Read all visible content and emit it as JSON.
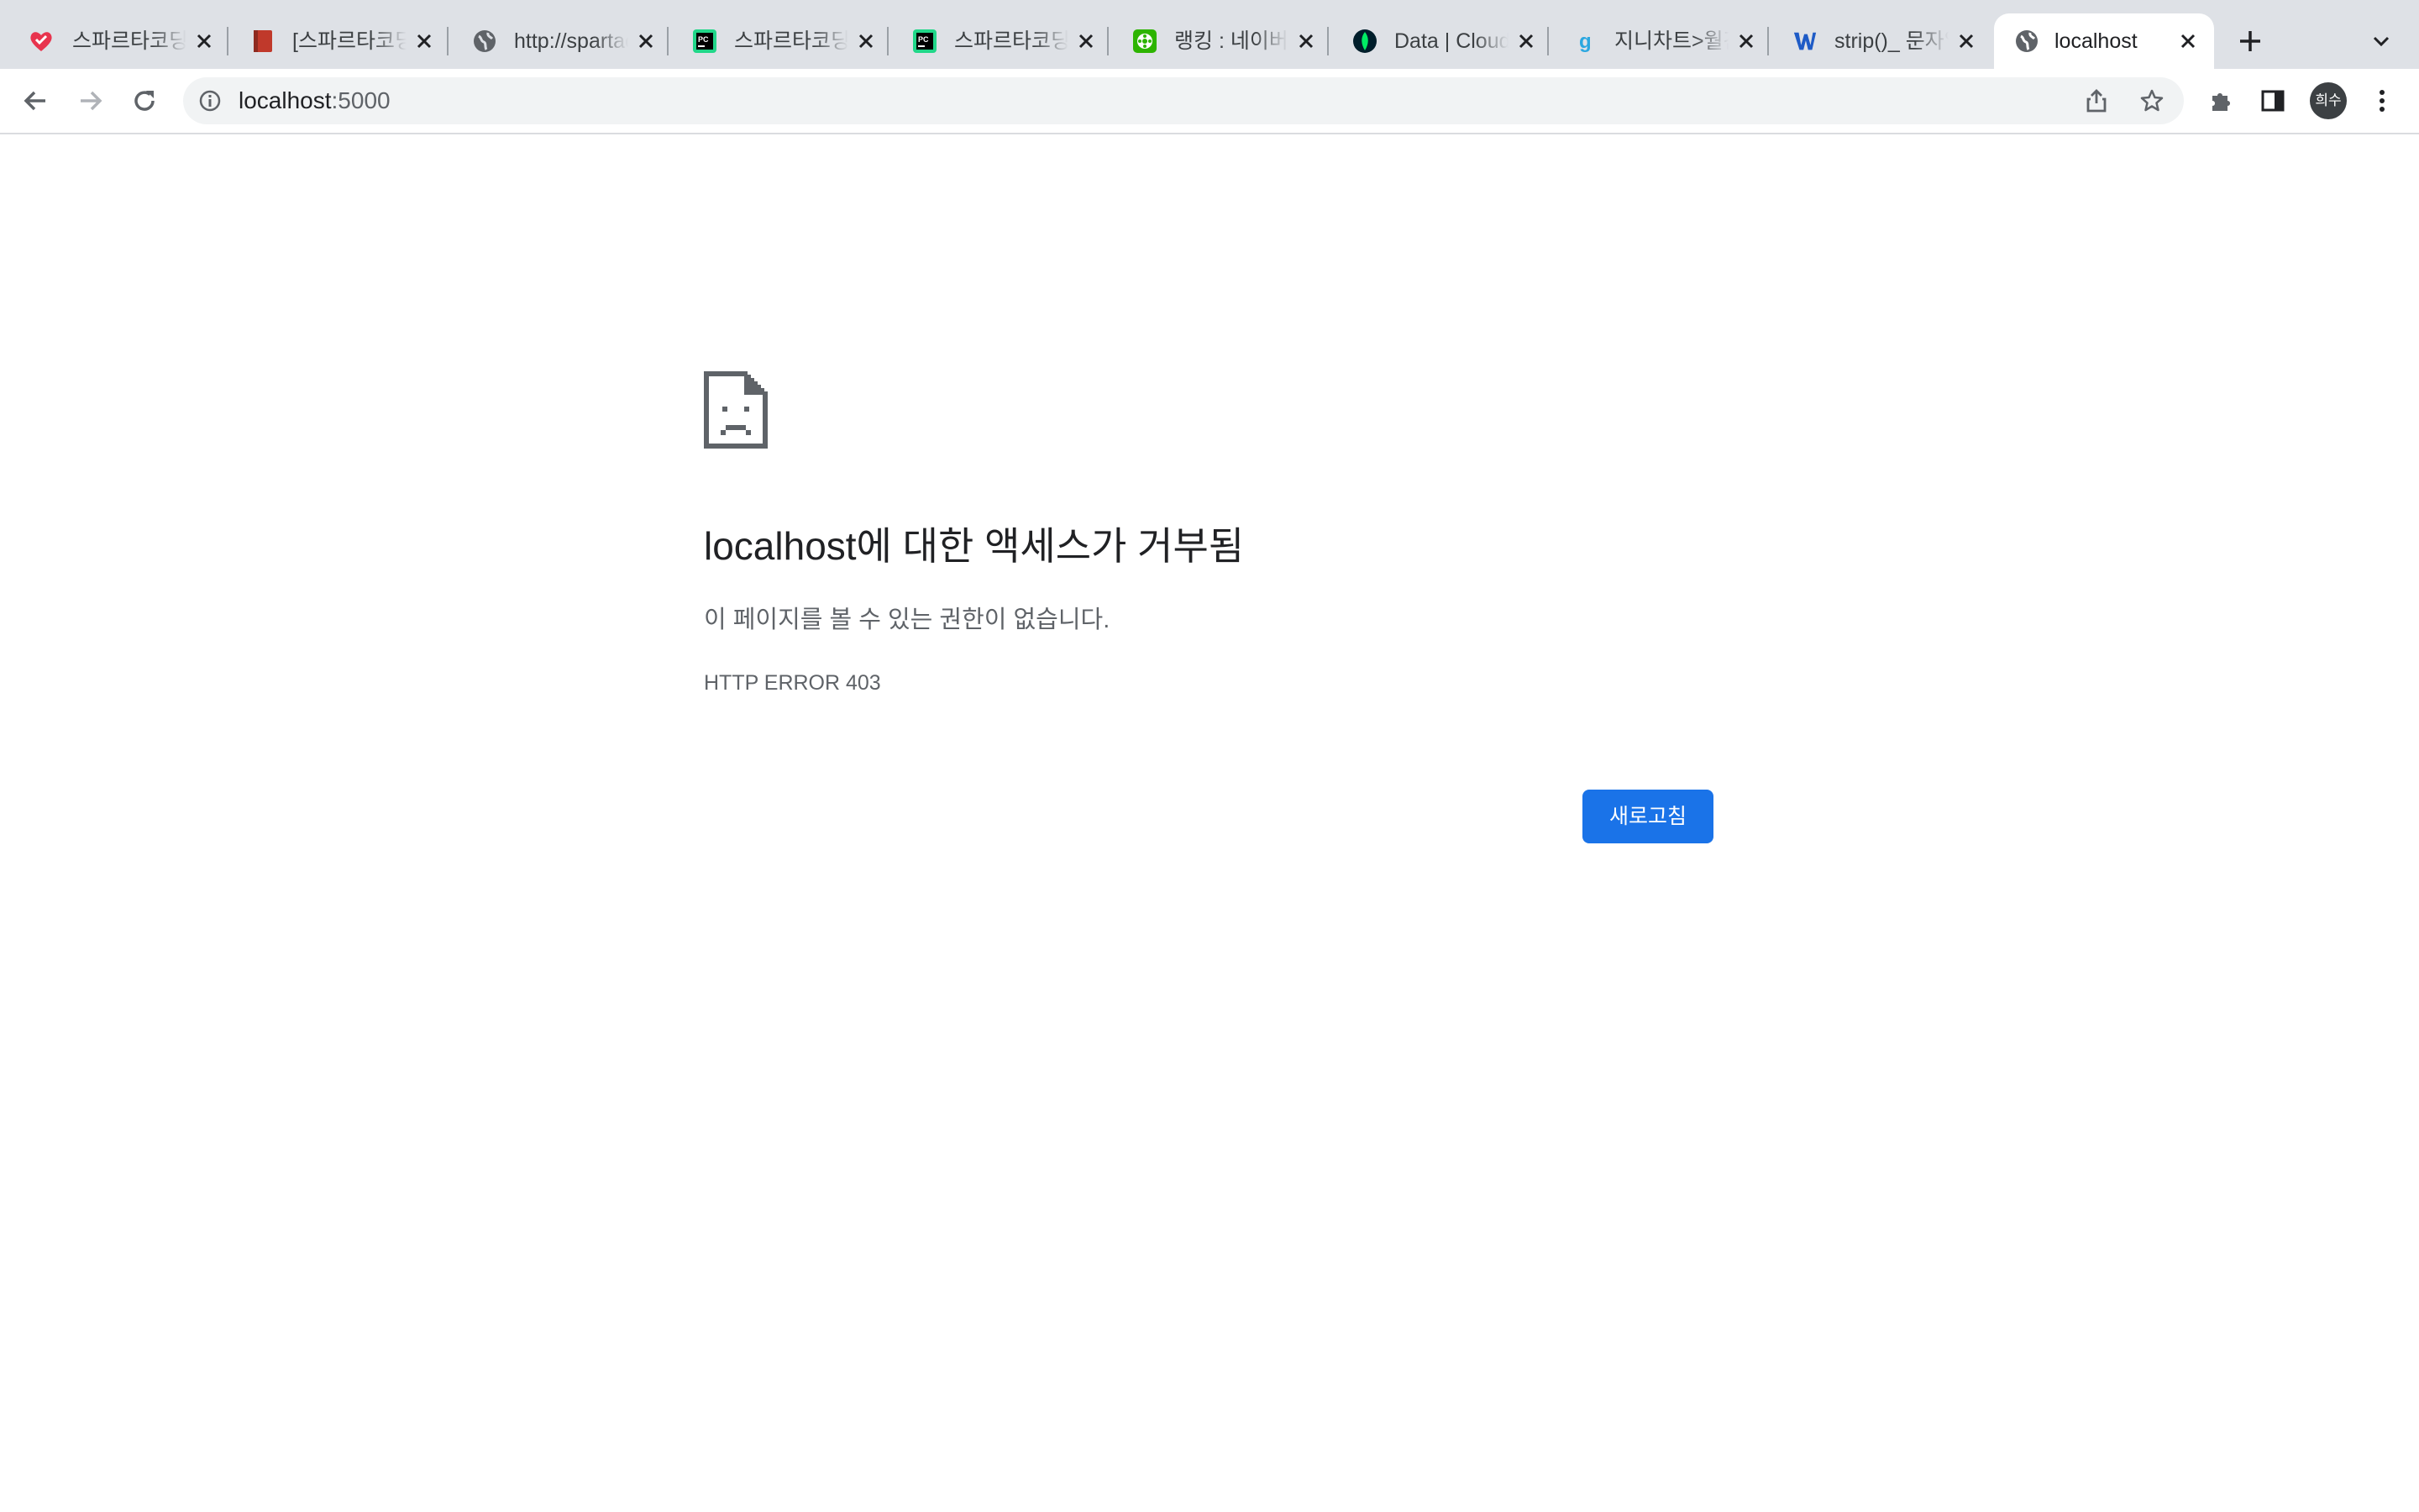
{
  "browser": {
    "tabs": [
      {
        "title": "스파르타코딩클럽",
        "favicon": "sparta-heart-icon"
      },
      {
        "title": "[스파르타코딩클럽]",
        "favicon": "red-book-icon"
      },
      {
        "title": "http://spartacodingclub",
        "favicon": "globe-icon"
      },
      {
        "title": "스파르타코딩클럽",
        "favicon": "pycharm-icon"
      },
      {
        "title": "스파르타코딩클럽",
        "favicon": "pycharm-icon"
      },
      {
        "title": "랭킹 : 네이버 영화",
        "favicon": "naver-movie-icon"
      },
      {
        "title": "Data | Cloud",
        "favicon": "mongodb-leaf-icon"
      },
      {
        "title": "지니차트>월간",
        "favicon": "genie-icon"
      },
      {
        "title": "strip()_ 문자열",
        "favicon": "w3-icon"
      },
      {
        "title": "localhost",
        "favicon": "globe-icon",
        "active": true
      }
    ],
    "address": {
      "host": "localhost",
      "port": ":5000"
    },
    "profile_initials": "희수",
    "accent_color": "#1a73e8"
  },
  "error_page": {
    "icon": "sad-page-icon",
    "title": "localhost에 대한 액세스가 거부됨",
    "description": "이 페이지를 볼 수 있는 권한이 없습니다.",
    "error_code": "HTTP ERROR 403",
    "reload_label": "새로고침"
  }
}
